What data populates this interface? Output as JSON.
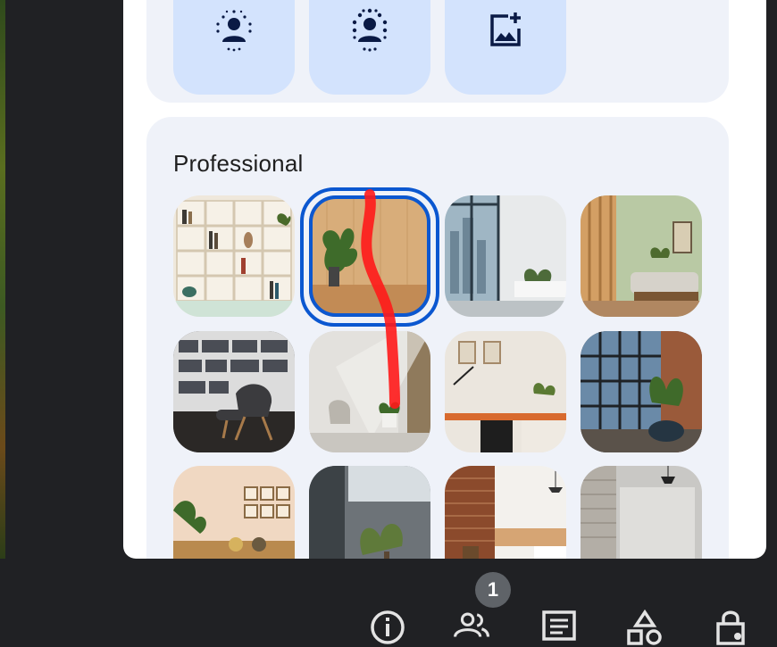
{
  "professional": {
    "title": "Professional"
  },
  "toolbar": {
    "badge_count": "1"
  },
  "colors": {
    "card_bg": "#eff2f9",
    "tile_bg": "#d3e3fd",
    "accent": "#0b57d0",
    "toolbar_bg": "#202124",
    "badge_bg": "#5f6368",
    "ink": "#ff0000"
  },
  "icons": {
    "top_tiles": [
      "portrait-blur-icon",
      "portrait-blur-icon",
      "add-photo-icon"
    ],
    "toolbar": [
      "info-icon",
      "people-icon",
      "chat-icon",
      "shapes-icon",
      "lock-person-icon"
    ]
  }
}
